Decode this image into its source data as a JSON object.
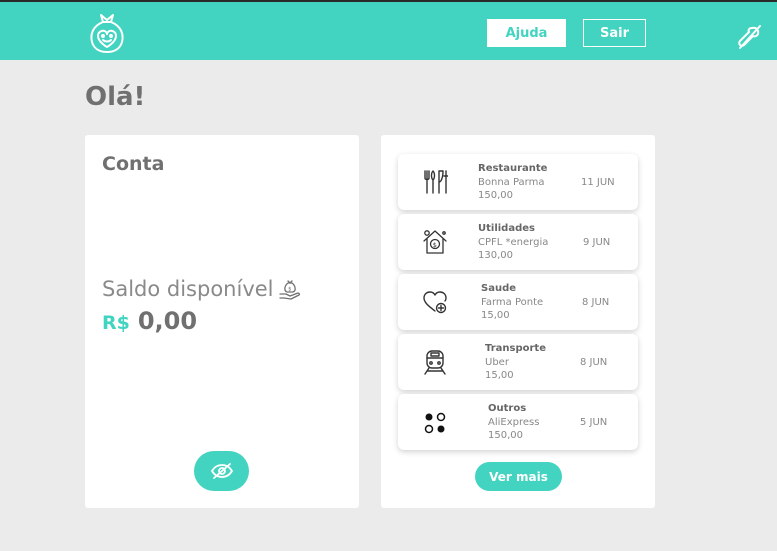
{
  "header": {
    "help_label": "Ajuda",
    "exit_label": "Sair",
    "accent_color": "#42d4c0",
    "logo_icon": "smiling-money-bag-icon",
    "right_icon": "crossed-out-tool-icon"
  },
  "greeting": "Olá!",
  "account": {
    "title": "Conta",
    "balance_label": "Saldo disponível",
    "currency": "R$",
    "balance": "0,00",
    "balance_icon": "money-bag-hand-icon",
    "toggle_icon": "eye-slash-icon"
  },
  "transactions": [
    {
      "category": "Restaurante",
      "merchant": "Bonna Parma",
      "value": "150,00",
      "date": "11 JUN",
      "icon": "cutlery-icon"
    },
    {
      "category": "Utilidades",
      "merchant": "CPFL *energia",
      "value": "130,00",
      "date": "9 JUN",
      "icon": "house-bill-icon"
    },
    {
      "category": "Saude",
      "merchant": "Farma Ponte",
      "value": "15,00",
      "date": "8 JUN",
      "icon": "heart-plus-icon"
    },
    {
      "category": "Transporte",
      "merchant": "Uber",
      "value": "15,00",
      "date": "8 JUN",
      "icon": "train-icon"
    },
    {
      "category": "Outros",
      "merchant": "AliExpress",
      "value": "150,00",
      "date": "5 JUN",
      "icon": "dots-grid-icon"
    }
  ],
  "more_label": "Ver mais"
}
